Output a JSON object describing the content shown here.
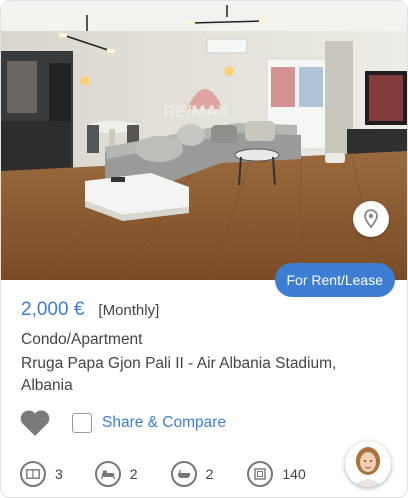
{
  "listing": {
    "watermark": "RE/MAX",
    "badge": "For Rent/Lease",
    "price": "2,000 €",
    "period": "[Monthly]",
    "type": "Condo/Apartment",
    "address": "Rruga Papa Gjon Pali II - Air Albania Stadium, Albania",
    "share_label": "Share & Compare",
    "accent_color": "#3d7ed3"
  },
  "features": [
    {
      "icon": "rooms-icon",
      "value": "3"
    },
    {
      "icon": "bed-icon",
      "value": "2"
    },
    {
      "icon": "bathtub-icon",
      "value": "2"
    },
    {
      "icon": "area-icon",
      "value": "140"
    }
  ]
}
